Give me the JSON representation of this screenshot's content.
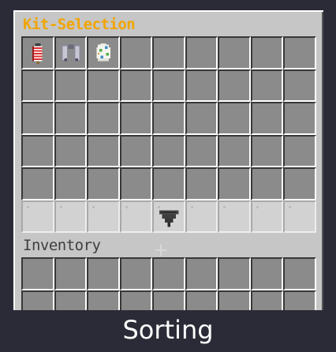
{
  "window": {
    "title": "Kit-Selection",
    "inventory_label": "Inventory"
  },
  "colors": {
    "title": "#f0a500",
    "panel": "#c6c6c6",
    "slot": "#8b8b8b",
    "background": "#2b2b38"
  },
  "kit_grid": {
    "columns": 9,
    "rows": 6,
    "highlighted_row": 6,
    "items": [
      {
        "row": 1,
        "col": 1,
        "icon": "firework-rocket-icon"
      },
      {
        "row": 1,
        "col": 2,
        "icon": "elytra-icon"
      },
      {
        "row": 1,
        "col": 3,
        "icon": "spawn-egg-icon"
      },
      {
        "row": 6,
        "col": 5,
        "icon": "hopper-icon"
      }
    ]
  },
  "inventory_grid": {
    "columns": 9,
    "rows_visible": 2
  },
  "caption": "Sorting"
}
